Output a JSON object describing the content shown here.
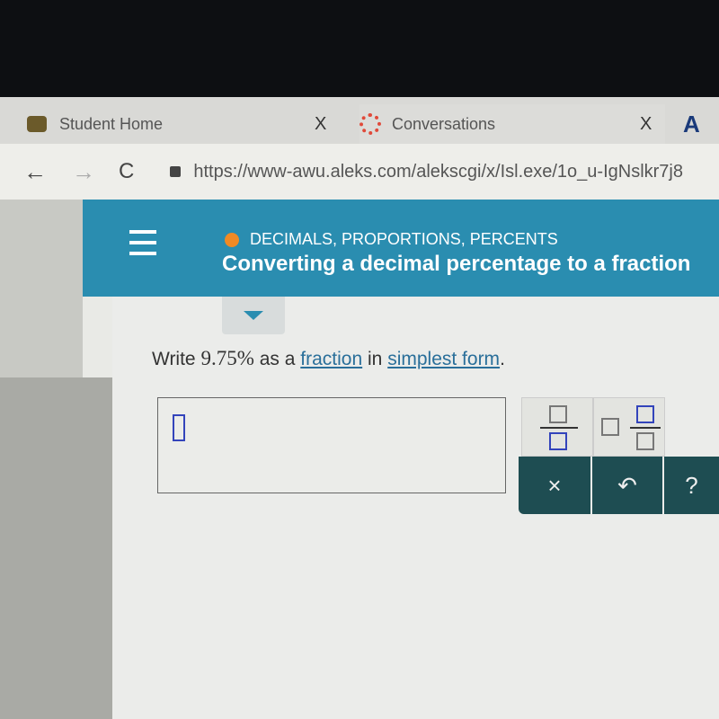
{
  "browser": {
    "tabs": [
      {
        "label": "Student Home",
        "close": "X"
      },
      {
        "label": "Conversations",
        "close": "X"
      },
      {
        "label": "A"
      }
    ],
    "url": "https://www-awu.aleks.com/alekscgi/x/Isl.exe/1o_u-IgNslkr7j8"
  },
  "header": {
    "topic": "DECIMALS, PROPORTIONS, PERCENTS",
    "title": "Converting a decimal percentage to a fraction",
    "accent": "#f08a24",
    "bg": "#2a8db0"
  },
  "question": {
    "prefix": "Write",
    "value": "9.75%",
    "mid": "as a",
    "link1": "fraction",
    "mid2": "in",
    "link2": "simplest form",
    "suffix": "."
  },
  "keypad": {
    "clear": "×",
    "undo": "↶",
    "help": "?"
  }
}
